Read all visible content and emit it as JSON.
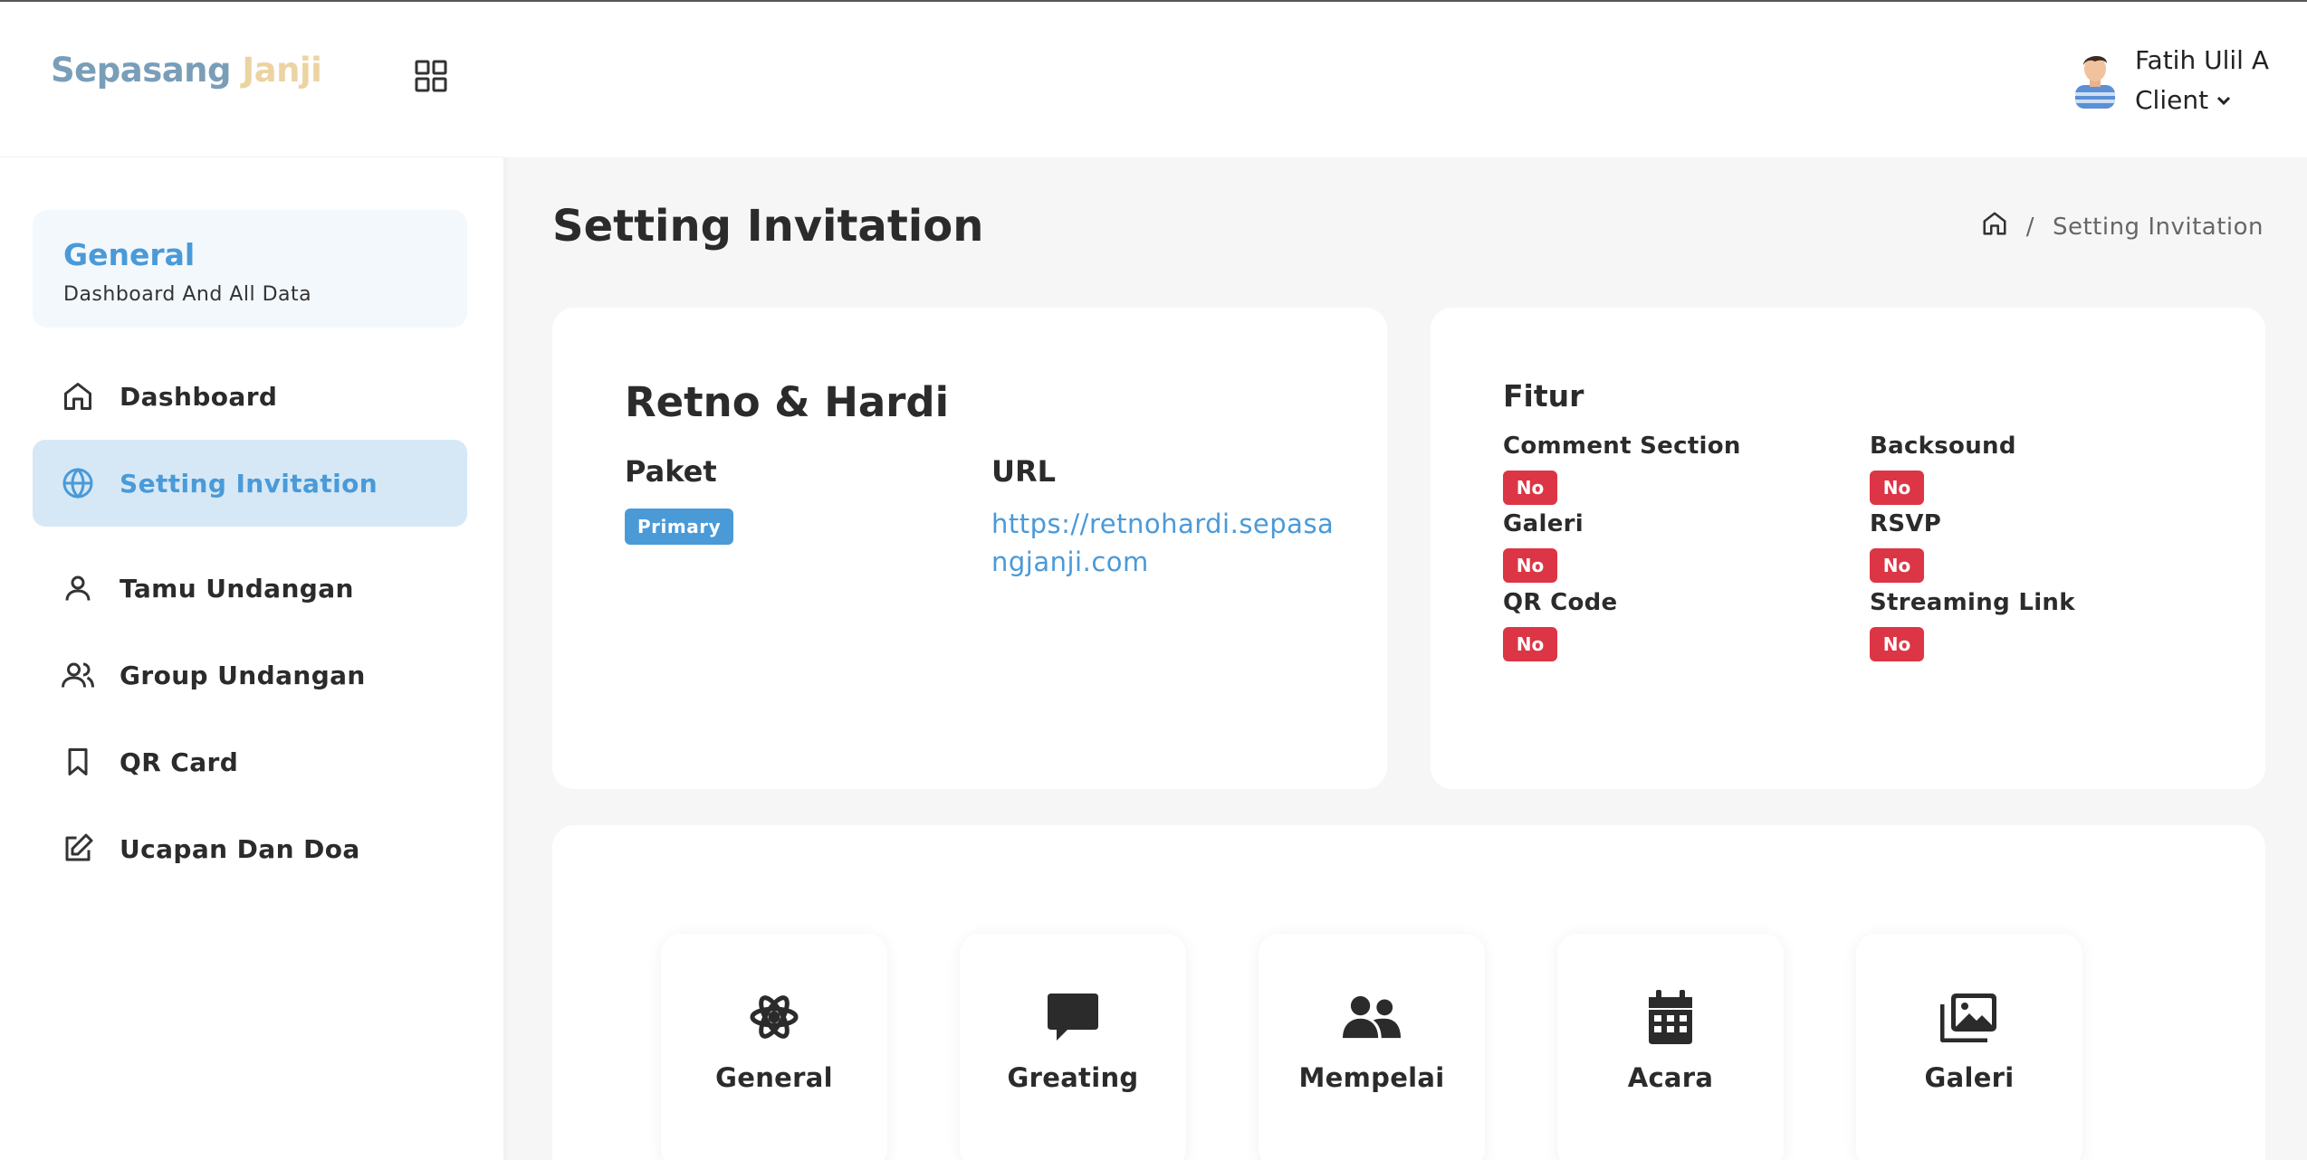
{
  "brand": {
    "part1": "Sepasang",
    "part2": "Janji"
  },
  "sidebar": {
    "section": {
      "title": "General",
      "subtitle": "Dashboard And All Data"
    },
    "items": [
      {
        "label": "Dashboard",
        "icon": "home-icon"
      },
      {
        "label": "Setting Invitation",
        "icon": "globe-icon",
        "active": true
      },
      {
        "label": "Tamu Undangan",
        "icon": "user-icon"
      },
      {
        "label": "Group Undangan",
        "icon": "users-icon"
      },
      {
        "label": "QR Card",
        "icon": "bookmark-icon"
      },
      {
        "label": "Ucapan Dan Doa",
        "icon": "edit-icon"
      }
    ]
  },
  "header": {
    "user_name": "Fatih Ulil A",
    "user_role": "Client"
  },
  "page": {
    "title": "Setting Invitation"
  },
  "breadcrumb": {
    "separator": "/",
    "current": "Setting Invitation"
  },
  "invitation": {
    "couple": "Retno & Hardi",
    "paket_label": "Paket",
    "paket_value": "Primary",
    "url_label": "URL",
    "url_value": "https://retnohardi.sepasangjanji.com"
  },
  "fitur": {
    "title": "Fitur",
    "items": [
      {
        "label": "Comment Section",
        "value": "No"
      },
      {
        "label": "Backsound",
        "value": "No"
      },
      {
        "label": "Galeri",
        "value": "No"
      },
      {
        "label": "RSVP",
        "value": "No"
      },
      {
        "label": "QR Code",
        "value": "No"
      },
      {
        "label": "Streaming Link",
        "value": "No"
      }
    ]
  },
  "menu_tiles": [
    {
      "label": "General",
      "icon": "atom-icon"
    },
    {
      "label": "Greating",
      "icon": "message-icon"
    },
    {
      "label": "Mempelai",
      "icon": "couple-icon"
    },
    {
      "label": "Acara",
      "icon": "calendar-icon"
    },
    {
      "label": "Galeri",
      "icon": "images-icon"
    }
  ],
  "colors": {
    "accent": "#4a9ad8",
    "danger": "#dc3545",
    "logo_primary": "#7a9eb8",
    "logo_secondary": "#ecd3a2"
  }
}
